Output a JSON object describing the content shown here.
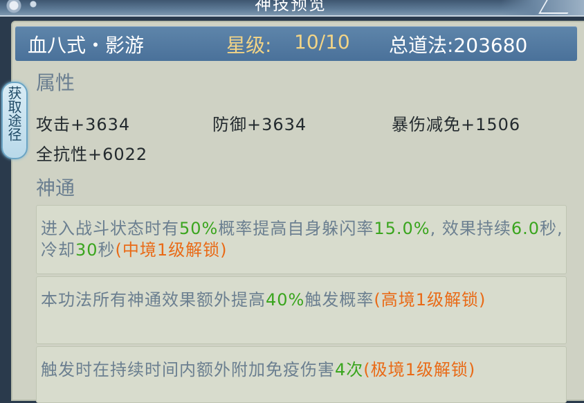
{
  "window": {
    "title_fragment": "神技预览"
  },
  "header": {
    "name": "血八式・影游",
    "star_label": "星级:",
    "star_value": "10/10",
    "total": "总道法:203680"
  },
  "side_tab": {
    "label": "获取途径"
  },
  "attributes": {
    "title": "属性",
    "items": [
      "攻击+3634",
      "防御+3634",
      "暴伤减免+1506",
      "全抗性+6022"
    ]
  },
  "abilities": {
    "title": "神通",
    "items": [
      {
        "parts": [
          {
            "text": "进入战斗状态时有",
            "color": "normal"
          },
          {
            "text": "50%",
            "color": "green"
          },
          {
            "text": "概率提高自身躲闪率",
            "color": "normal"
          },
          {
            "text": "15.0%",
            "color": "green"
          },
          {
            "text": ", 效果持续",
            "color": "normal"
          },
          {
            "text": "6.0",
            "color": "green"
          },
          {
            "text": "秒, 冷却",
            "color": "normal"
          },
          {
            "text": "30",
            "color": "green"
          },
          {
            "text": "秒",
            "color": "normal"
          },
          {
            "text": "(中境1级解锁)",
            "color": "orange"
          }
        ]
      },
      {
        "parts": [
          {
            "text": "本功法所有神通效果额外提高",
            "color": "normal"
          },
          {
            "text": "40%",
            "color": "green"
          },
          {
            "text": "触发概率",
            "color": "normal"
          },
          {
            "text": "(高境1级解锁)",
            "color": "orange"
          }
        ]
      },
      {
        "parts": [
          {
            "text": "触发时在持续时间内额外附加免疫伤害",
            "color": "normal"
          },
          {
            "text": "4次",
            "color": "green"
          },
          {
            "text": "(极境1级解锁)",
            "color": "orange"
          }
        ]
      }
    ]
  },
  "colors": {
    "normal": "#6b7f90",
    "green": "#3aa51e",
    "orange": "#e96a16",
    "header_bg": "#4a719a",
    "star_gold": "#f2d486"
  }
}
